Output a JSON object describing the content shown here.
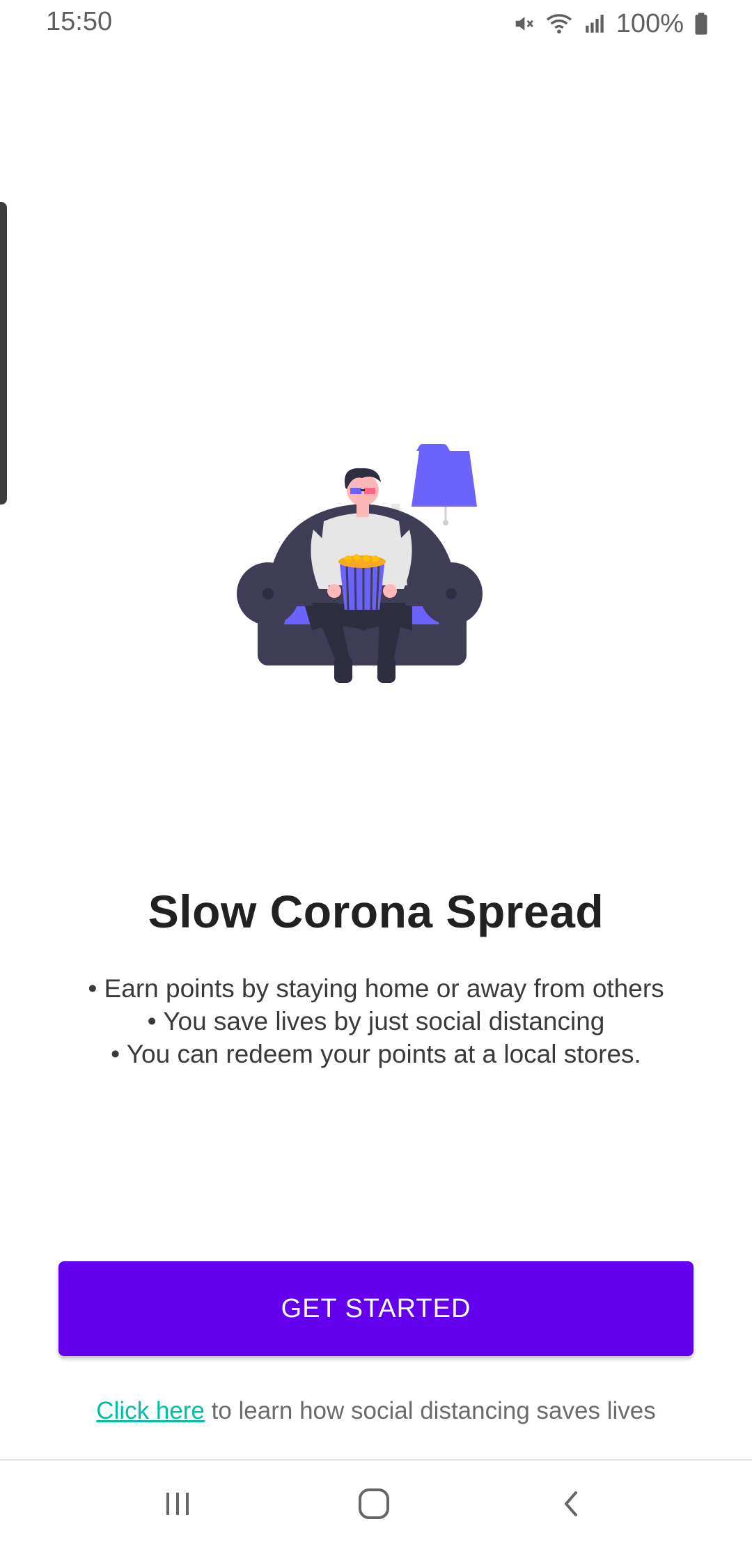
{
  "status_bar": {
    "time": "15:50",
    "battery_text": "100%",
    "icons": [
      "mute-icon",
      "wifi-icon",
      "signal-icon",
      "battery-icon"
    ]
  },
  "onboarding": {
    "illustration": "person-on-couch-with-popcorn-illustration",
    "title": "Slow Corona Spread",
    "bullets": [
      "• Earn points by staying home or away from others",
      "• You save lives by just social distancing",
      "• You can redeem your points at a local stores."
    ],
    "cta_label": "GET STARTED",
    "footer_link": "Click here",
    "footer_text": " to learn how social distancing saves lives"
  },
  "nav": {
    "icons": [
      "recents-icon",
      "home-icon",
      "back-icon"
    ]
  },
  "colors": {
    "accent": "#6200ee",
    "link": "#00bfa5",
    "illustration_purple": "#6c63ff",
    "couch": "#3f3d56"
  }
}
